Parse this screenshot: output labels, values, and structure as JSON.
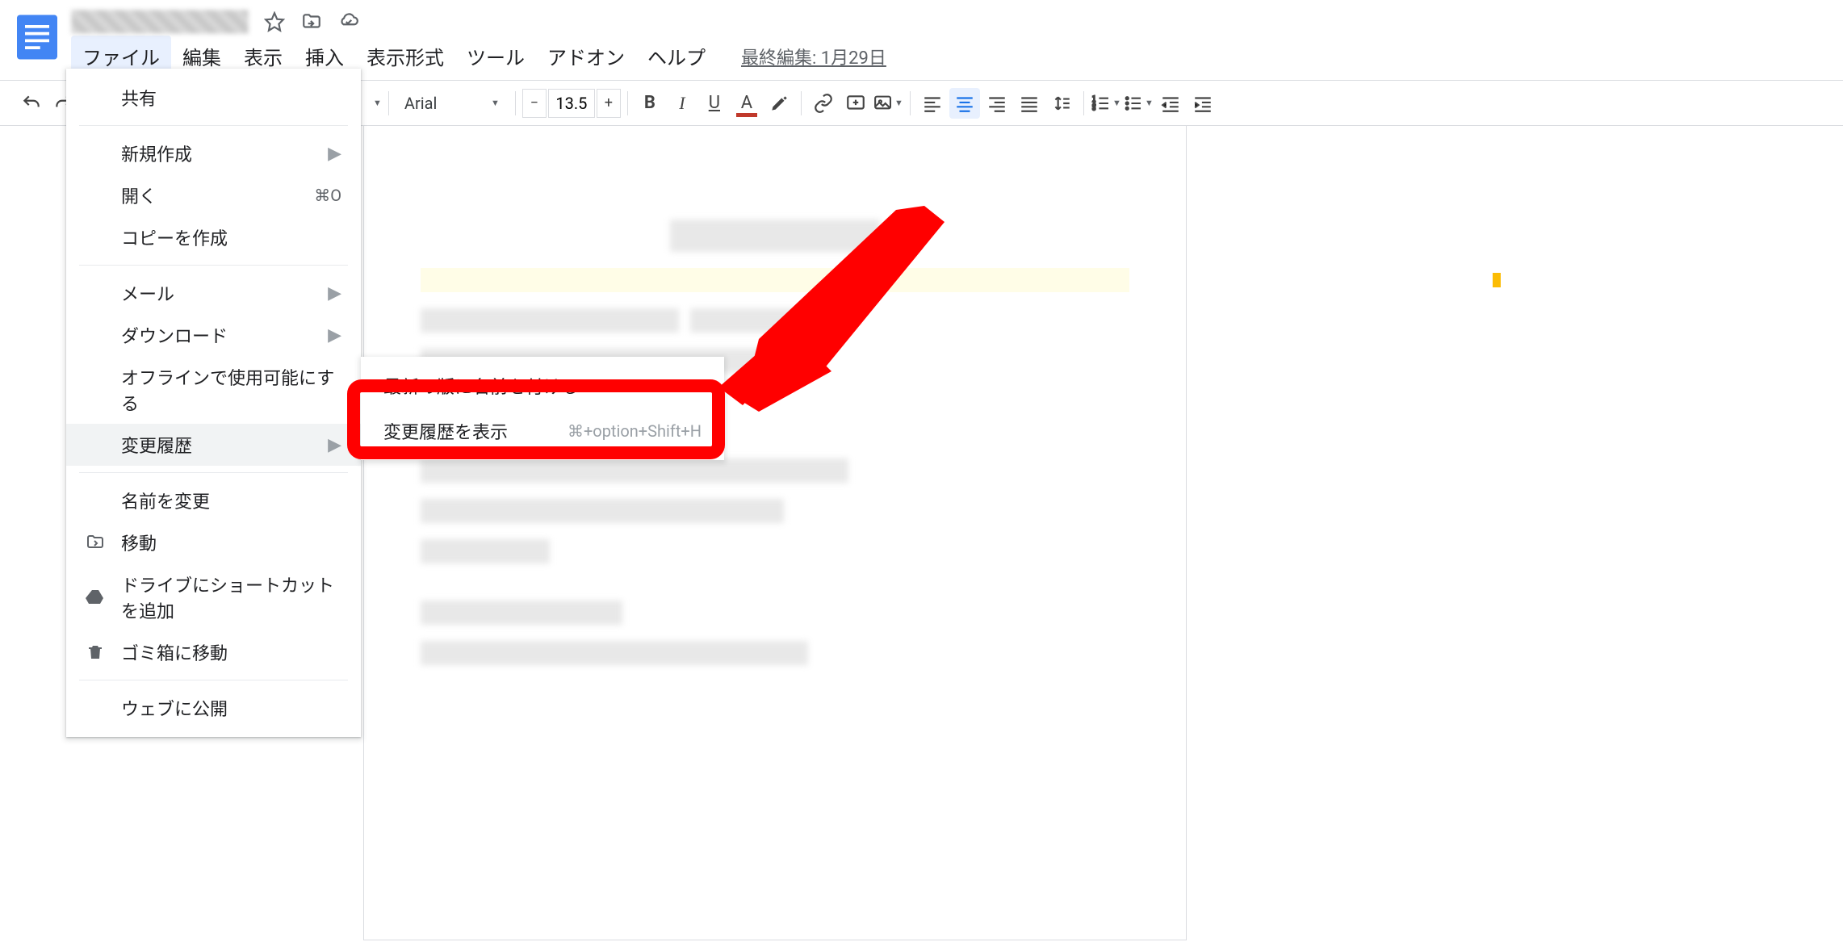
{
  "header": {
    "doc_title": "(redacted)",
    "last_edit": "最終編集: 1月29日"
  },
  "menus": {
    "file": "ファイル",
    "edit": "編集",
    "view": "表示",
    "insert": "挿入",
    "format": "表示形式",
    "tools": "ツール",
    "addons": "アドオン",
    "help": "ヘルプ"
  },
  "toolbar": {
    "font": "Arial",
    "font_size": "13.5"
  },
  "file_menu": {
    "share": "共有",
    "new": "新規作成",
    "open": "開く",
    "open_shortcut": "⌘O",
    "copy": "コピーを作成",
    "mail": "メール",
    "download": "ダウンロード",
    "offline": "オフラインで使用可能にする",
    "history": "変更履歴",
    "rename": "名前を変更",
    "move": "移動",
    "shortcut": "ドライブにショートカットを追加",
    "trash": "ゴミ箱に移動",
    "publish": "ウェブに公開"
  },
  "submenu": {
    "name_version": "最新の版に名前を付ける",
    "show_history": "変更履歴を表示",
    "show_history_shortcut": "⌘+option+Shift+H"
  }
}
